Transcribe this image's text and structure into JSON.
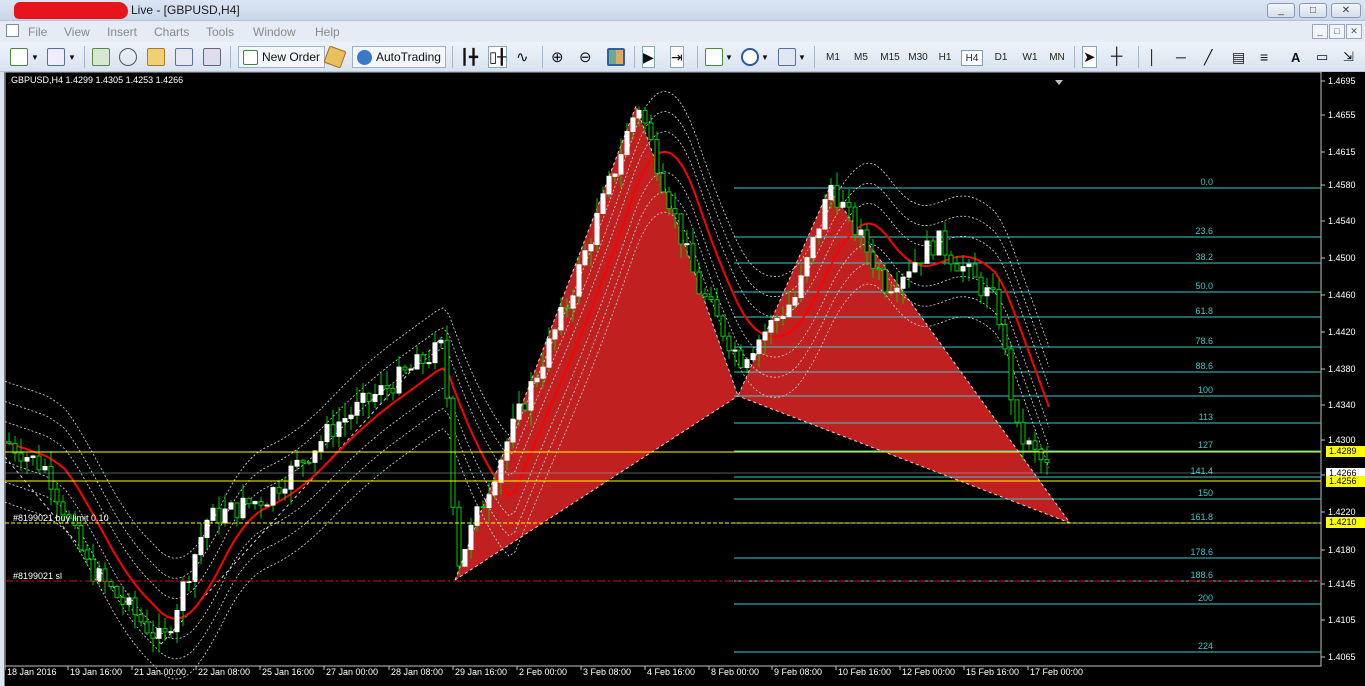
{
  "window": {
    "title": "Live - [GBPUSD,H4]",
    "controls": [
      "_",
      "□",
      "✕"
    ]
  },
  "menu": [
    "File",
    "View",
    "Insert",
    "Charts",
    "Tools",
    "Window",
    "Help"
  ],
  "toolbar": {
    "new_order": "New Order",
    "autotrading": "AutoTrading",
    "timeframes": [
      "M1",
      "M5",
      "M15",
      "M30",
      "H1",
      "H4",
      "D1",
      "W1",
      "MN"
    ],
    "active_timeframe": "H4"
  },
  "symbol_info": "GBPUSD,H4  1.4299 1.4305 1.4253 1.4266",
  "orders": [
    {
      "label": "#8199021 buy limit 0.10",
      "price": 1.421,
      "color": "#ffff00"
    },
    {
      "label": "#8199021 sl",
      "price": 1.4146,
      "color": "#d01010"
    }
  ],
  "price_axis": {
    "labels": [
      "1.4695",
      "1.4655",
      "1.4615",
      "1.4580",
      "1.4540",
      "1.4500",
      "1.4460",
      "1.4420",
      "1.4380",
      "1.4340",
      "1.4300",
      "1.4260",
      "1.4220",
      "1.4180",
      "1.4145",
      "1.4105",
      "1.4065"
    ],
    "tags": [
      {
        "text": "1.4289",
        "bg": "#ffff00"
      },
      {
        "text": "1.4266",
        "bg": "#ffffff"
      },
      {
        "text": "1.4256",
        "bg": "#ffff00"
      },
      {
        "text": "1.4210",
        "bg": "#ffff00"
      }
    ]
  },
  "time_axis": [
    "18 Jan 2016",
    "19 Jan 16:00",
    "21 Jan 00:00",
    "22 Jan 08:00",
    "25 Jan 16:00",
    "27 Jan 00:00",
    "28 Jan 08:00",
    "29 Jan 16:00",
    "2 Feb 00:00",
    "3 Feb 08:00",
    "4 Feb 16:00",
    "8 Feb 00:00",
    "9 Feb 08:00",
    "10 Feb 16:00",
    "12 Feb 00:00",
    "15 Feb 16:00",
    "17 Feb 00:00"
  ],
  "fibonacci": [
    "0.0",
    "23.6",
    "38.2",
    "50.0",
    "61.8",
    "78.6",
    "88.6",
    "100",
    "113",
    "127",
    "141.4",
    "150",
    "161.8",
    "178.6",
    "188.6",
    "200",
    "224"
  ],
  "colors": {
    "background": "#000000",
    "bull": "#ffffff",
    "bear": "#00cc00",
    "pattern": "#c02020",
    "ma": "#ff0000",
    "fib": "#40c8c8",
    "hline": "#ffff00",
    "sl": "#d01010"
  }
}
